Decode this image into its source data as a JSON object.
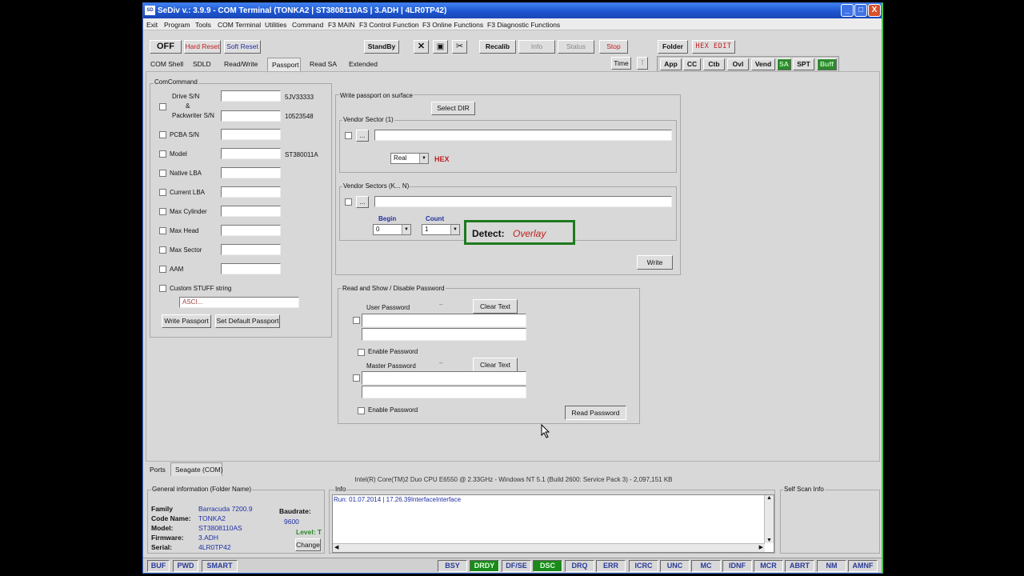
{
  "window": {
    "title": "SeDiv v.: 3.9.9 - COM Terminal  (TONKA2 | ST3808110AS | 3.ADH | 4LR0TP42)",
    "minimize": "_",
    "maximize": "□",
    "close": "X"
  },
  "menu": [
    "Exit",
    "Program",
    "Tools",
    "COM Terminal",
    "Utilities",
    "Command",
    "F3 MAIN",
    "F3 Control Function",
    "F3 Online Functions",
    "F3 Diagnostic Functions"
  ],
  "toolbar": {
    "off": "OFF",
    "hard_reset": "Hard Reset",
    "soft_reset": "Soft Reset",
    "standby": "StandBy",
    "close_glyph": "✕",
    "save_glyph": "▣",
    "tools_glyph": "✂",
    "recalib": "Recalib",
    "info": "Info",
    "status": "Status",
    "stop": "Stop",
    "folder": "Folder",
    "hex_edit": "HEX EDIT",
    "time": "Time",
    "right_tabs": [
      "App",
      "CC",
      "Ctb",
      "Ovl",
      "Vend",
      "SA",
      "SPT",
      "Buff"
    ]
  },
  "tabs": [
    "COM Shell",
    "SDLD",
    "Read/Write",
    "Passport",
    "Read SA",
    "Extended"
  ],
  "com_command": {
    "title": "ComCommand",
    "drive_sn_label": "Drive S/N",
    "and_label": "&",
    "packwriter_label": "Packwriter S/N",
    "drive_sn_value": "5JV33333",
    "packwriter_value": "10523548",
    "rows": [
      {
        "label": "PCBA S/N",
        "value": ""
      },
      {
        "label": "Model",
        "value": "ST380011A"
      },
      {
        "label": "Native LBA",
        "value": ""
      },
      {
        "label": "Current LBA",
        "value": ""
      },
      {
        "label": "Max Cylinder",
        "value": ""
      },
      {
        "label": "Max Head",
        "value": ""
      },
      {
        "label": "Max Sector",
        "value": ""
      },
      {
        "label": "AAM",
        "value": ""
      }
    ],
    "custom_label": "Custom STUFF string",
    "custom_placeholder": "ASCI...",
    "write_passport": "Write Passport",
    "set_default": "Set Default Passport"
  },
  "write_passport": {
    "title": "Write passport on surface",
    "select_dir": "Select DIR",
    "vendor_sector_1": "Vendor Sector (1)",
    "browse": "...",
    "mode": "Real",
    "hex": "HEX",
    "vendor_sectors_kn": "Vendor Sectors (K... N)",
    "begin_label": "Begin",
    "begin_value": "0",
    "count_label": "Count",
    "count_value": "1",
    "detect_label": "Detect:",
    "detect_value": "Overlay",
    "write": "Write"
  },
  "password": {
    "title": "Read and Show / Disable Password",
    "user_label": "User Password",
    "master_label": "Master Password",
    "clear_text": "Clear Text",
    "enable_password": "Enable Password",
    "read_password": "Read Password"
  },
  "bottom_tabs": [
    "Ports",
    "Seagate (COM)"
  ],
  "cpu_info": "Intel(R) Core(TM)2 Duo CPU    E6550 @ 2.33GHz - Windows NT 5.1 (Build 2600: Service Pack 3) - 2,097,151 KB",
  "general_info": {
    "title": "General information (Folder Name)",
    "family_label": "Family",
    "family_value": "Barracuda 7200.9",
    "code_label": "Code Name:",
    "code_value": "TONKA2",
    "model_label": "Model:",
    "model_value": "ST3808110AS",
    "firmware_label": "Firmware:",
    "firmware_value": "3.ADH",
    "serial_label": "Serial:",
    "serial_value": "4LR0TP42",
    "baud_label": "Baudrate:",
    "baud_value": "9600",
    "level": "Level: T",
    "change": "Change"
  },
  "info_panel": {
    "title": "Info",
    "log": "Run: 01.07.2014 | 17.26.39InterfaceInterface"
  },
  "self_scan": {
    "title": "Self Scan Info"
  },
  "status_left": [
    "BUF",
    "PWD",
    "SMART"
  ],
  "status_flags": [
    {
      "label": "BSY",
      "on": false
    },
    {
      "label": "DRDY",
      "on": true
    },
    {
      "label": "DF/SE",
      "on": false
    },
    {
      "label": "DSC",
      "on": true
    },
    {
      "label": "DRQ",
      "on": false
    },
    {
      "label": "ERR",
      "on": false
    },
    {
      "label": "ICRC",
      "on": false
    },
    {
      "label": "UNC",
      "on": false
    },
    {
      "label": "MC",
      "on": false
    },
    {
      "label": "IDNF",
      "on": false
    },
    {
      "label": "MCR",
      "on": false
    },
    {
      "label": "ABRT",
      "on": false
    },
    {
      "label": "NM",
      "on": false
    },
    {
      "label": "AMNF",
      "on": false
    }
  ],
  "colors": {
    "detect_border": "#1d7a1d",
    "led_on": "#1a8a1a",
    "title_bar": "#1e55d0"
  }
}
